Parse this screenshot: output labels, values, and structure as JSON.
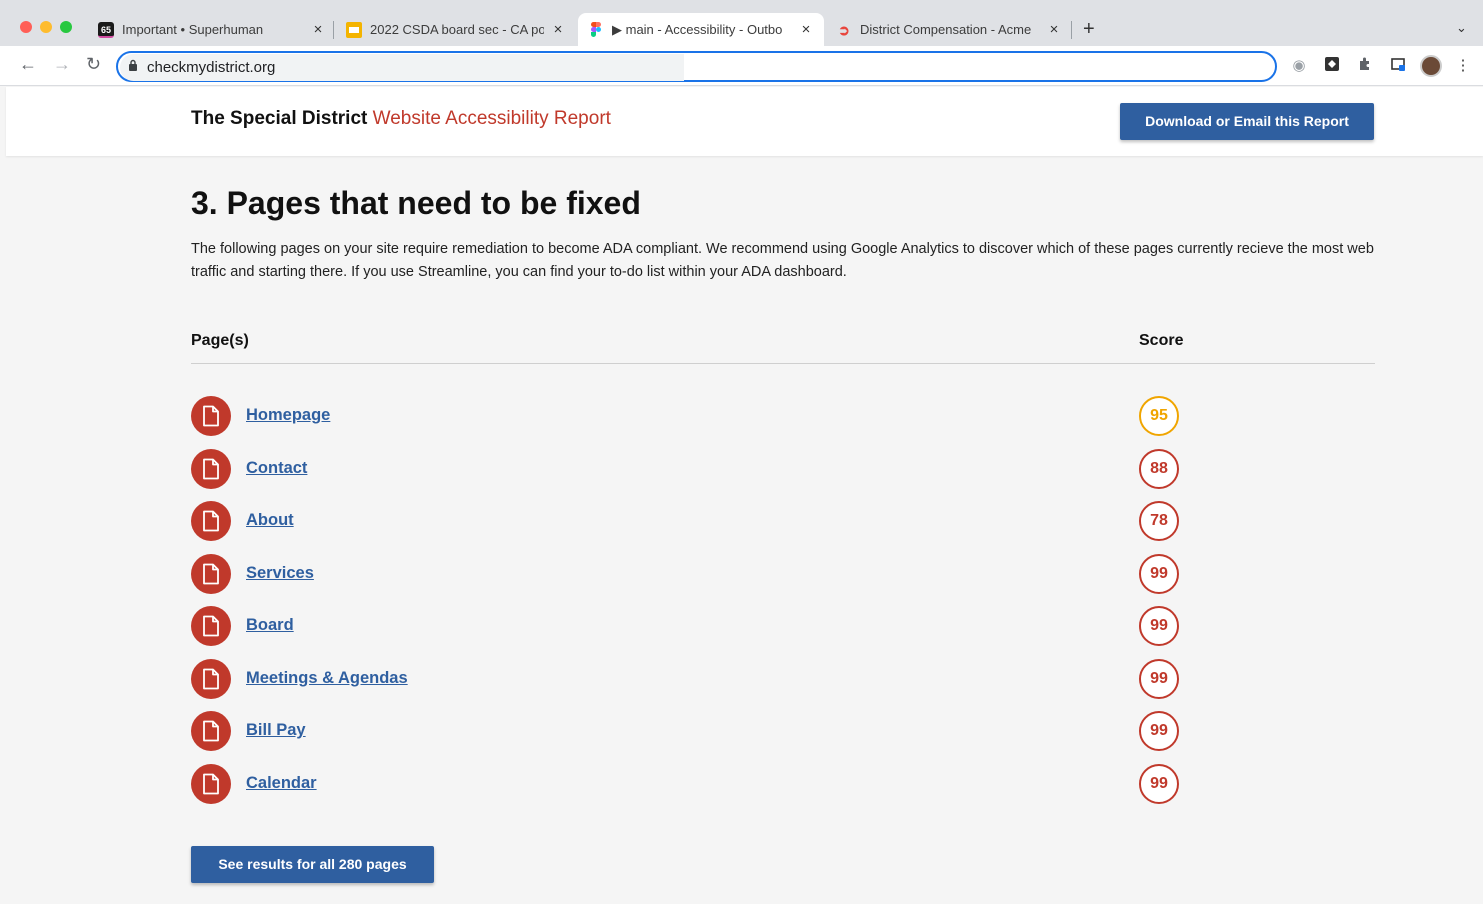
{
  "browser": {
    "tabs": [
      {
        "label": "Important • Superhuman",
        "favicon_text": "65",
        "icon": "superhuman-icon"
      },
      {
        "label": "2022 CSDA board sec - CA po",
        "icon": "slides-icon"
      },
      {
        "label": "▶ main - Accessibility - Outbo",
        "icon": "figma-icon"
      },
      {
        "label": "District Compensation - Acme",
        "icon": "doordash-icon"
      }
    ],
    "new_tab": "+",
    "address": "checkmydistrict.org"
  },
  "header": {
    "brand_bold": "The Special District",
    "brand_red": "Website Accessibility Report",
    "download_label": "Download or Email this Report"
  },
  "section": {
    "title": "3. Pages that need to be fixed",
    "intro": "The following pages on your site require remediation to become ADA compliant. We recommend using Google Analytics to discover which of these pages currently recieve the most web traffic and starting there. If you use Streamline, you can find your to-do list within your ADA dashboard."
  },
  "table": {
    "col_pages": "Page(s)",
    "col_score": "Score",
    "rows": [
      {
        "page": "Homepage",
        "score": "95",
        "status": "warn"
      },
      {
        "page": "Contact",
        "score": "88",
        "status": "fail"
      },
      {
        "page": "About",
        "score": "78",
        "status": "fail"
      },
      {
        "page": "Services",
        "score": "99",
        "status": "fail"
      },
      {
        "page": "Board",
        "score": "99",
        "status": "fail"
      },
      {
        "page": "Meetings & Agendas",
        "score": "99",
        "status": "fail"
      },
      {
        "page": "Bill Pay",
        "score": "99",
        "status": "fail"
      },
      {
        "page": "Calendar",
        "score": "99",
        "status": "fail"
      }
    ]
  },
  "see_all_label": "See results for all 280 pages",
  "colors": {
    "accent": "#2f5fa0",
    "danger": "#c0392b",
    "warning": "#f0a500"
  }
}
